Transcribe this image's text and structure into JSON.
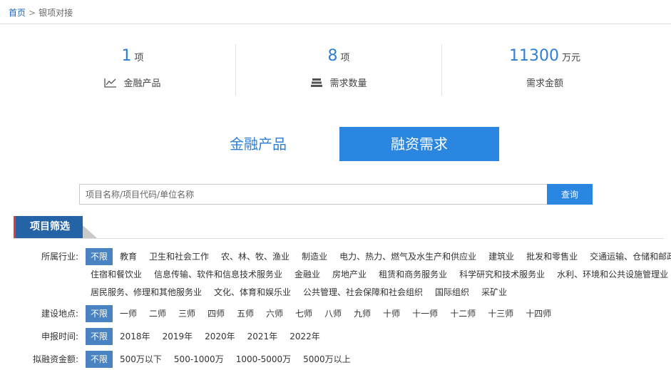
{
  "breadcrumb": {
    "home": "首页",
    "sep": ">",
    "current": "银项对接"
  },
  "stats": [
    {
      "value": "1",
      "unit": "项",
      "label": "金融产品",
      "icon": "line-chart-icon"
    },
    {
      "value": "8",
      "unit": "项",
      "label": "需求数量",
      "icon": "stack-icon"
    },
    {
      "value": "11300",
      "unit": "万元",
      "label": "需求金额",
      "icon": ""
    }
  ],
  "tabs": {
    "products": "金融产品",
    "demand": "融资需求"
  },
  "search": {
    "placeholder": "项目名称/项目代码/单位名称",
    "button": "查询"
  },
  "section_title": "项目筛选",
  "filters": {
    "industry": {
      "label": "所属行业:",
      "all": "不限",
      "lines": [
        [
          "教育",
          "卫生和社会工作",
          "农、林、牧、渔业",
          "制造业",
          "电力、热力、燃气及水生产和供应业",
          "建筑业",
          "批发和零售业",
          "交通运输、仓储和邮政业"
        ],
        [
          "住宿和餐饮业",
          "信息传输、软件和信息技术服务业",
          "金融业",
          "房地产业",
          "租赁和商务服务业",
          "科学研究和技术服务业",
          "水利、环境和公共设施管理业"
        ],
        [
          "居民服务、修理和其他服务业",
          "文化、体育和娱乐业",
          "公共管理、社会保障和社会组织",
          "国际组织",
          "采矿业"
        ]
      ]
    },
    "location": {
      "label": "建设地点:",
      "all": "不限",
      "options": [
        "一师",
        "二师",
        "三师",
        "四师",
        "五师",
        "六师",
        "七师",
        "八师",
        "九师",
        "十师",
        "十一师",
        "十二师",
        "十三师",
        "十四师"
      ]
    },
    "year": {
      "label": "申报时间:",
      "all": "不限",
      "options": [
        "2018年",
        "2019年",
        "2020年",
        "2021年",
        "2022年"
      ]
    },
    "amount": {
      "label": "拟融资金额:",
      "all": "不限",
      "options": [
        "500万以下",
        "500-1000万",
        "1000-5000万",
        "5000万以上"
      ]
    }
  }
}
